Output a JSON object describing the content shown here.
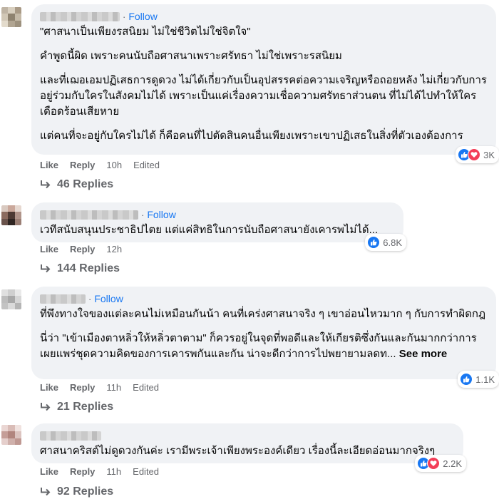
{
  "comments": [
    {
      "follow": "Follow",
      "dot": "·",
      "paragraphs": [
        "\"ศาสนาเป็นเพียงรสนิยม ไม่ใช่ชีวิตไม่ใช่จิตใจ\"",
        "คำพูดนี้ผิด เพราะคนนับถือศาสนาเพราะศรัทธา ไม่ใช่เพราะรสนิยม",
        "และที่เฌอเอมปฏิเสธการดูดวง ไม่ได้เกี่ยวกับเป็นอุปสรรคต่อความเจริญหรือถอยหลัง ไม่เกี่ยวกับการอยู่ร่วมกับใครในสังคมไม่ได้ เพราะเป็นแค่เรื่องความเชื่อความศรัทธาส่วนตน ที่ไม่ได้ไปทำให้ใครเดือดร้อนเสียหาย",
        "แต่คนที่จะอยู่กับใครไม่ได้ ก็คือคนที่ไปตัดสินคนอื่นเพียงเพราะเขาปฏิเสธในสิ่งที่ตัวเองต้องการ"
      ],
      "see_more": "",
      "reaction_count": "3K",
      "reactions": [
        "like",
        "love"
      ],
      "like": "Like",
      "reply": "Reply",
      "time": "10h",
      "edited": "Edited",
      "replies": "46 Replies"
    },
    {
      "follow": "Follow",
      "dot": "·",
      "paragraphs": [
        "เวทีสนับสนุนประชาธิปไตย แต่แค่สิทธิในการนับถือศาสนายังเคารพไม่ได้..."
      ],
      "see_more": "",
      "reaction_count": "6.8K",
      "reactions": [
        "like"
      ],
      "like": "Like",
      "reply": "Reply",
      "time": "12h",
      "edited": "",
      "replies": "144 Replies"
    },
    {
      "follow": "Follow",
      "dot": "·",
      "paragraphs": [
        "ที่พึงทางใจของแต่ละคนไม่เหมือนกันน้า คนที่เคร่งศาสนาจริง ๆ เขาอ่อนไหวมาก ๆ กับการทำผิดกฎ",
        "นี่ว่า \"เข้าเมืองตาหลิ่วให้หลิ่วตาตาม\" ก็ควรอยู่ในจุดที่พอดีและให้เกียรติซึ่งกันและกันมากกว่าการเผยแพร่ชุดความคิดของการเคารพกันและกัน น่าจะดีกว่าการไปพยายามลดท..."
      ],
      "see_more": "See more",
      "reaction_count": "1.1K",
      "reactions": [
        "like"
      ],
      "like": "Like",
      "reply": "Reply",
      "time": "11h",
      "edited": "Edited",
      "replies": "21 Replies"
    },
    {
      "follow": "",
      "dot": "",
      "paragraphs": [
        "ศาสนาคริสต์ไม่ดูดวงกันค่ะ เรามีพระเจ้าเพียงพระองค์เดียว เรื่องนี้ละเอียดอ่อนมากจริงๆ"
      ],
      "see_more": "",
      "reaction_count": "2.2K",
      "reactions": [
        "like",
        "love"
      ],
      "like": "Like",
      "reply": "Reply",
      "time": "11h",
      "edited": "Edited",
      "replies": "92 Replies"
    }
  ],
  "colors": {
    "accent": "#1877f2",
    "love": "#f33e58",
    "bubble": "#f0f2f5",
    "secondary_text": "#65676b"
  }
}
